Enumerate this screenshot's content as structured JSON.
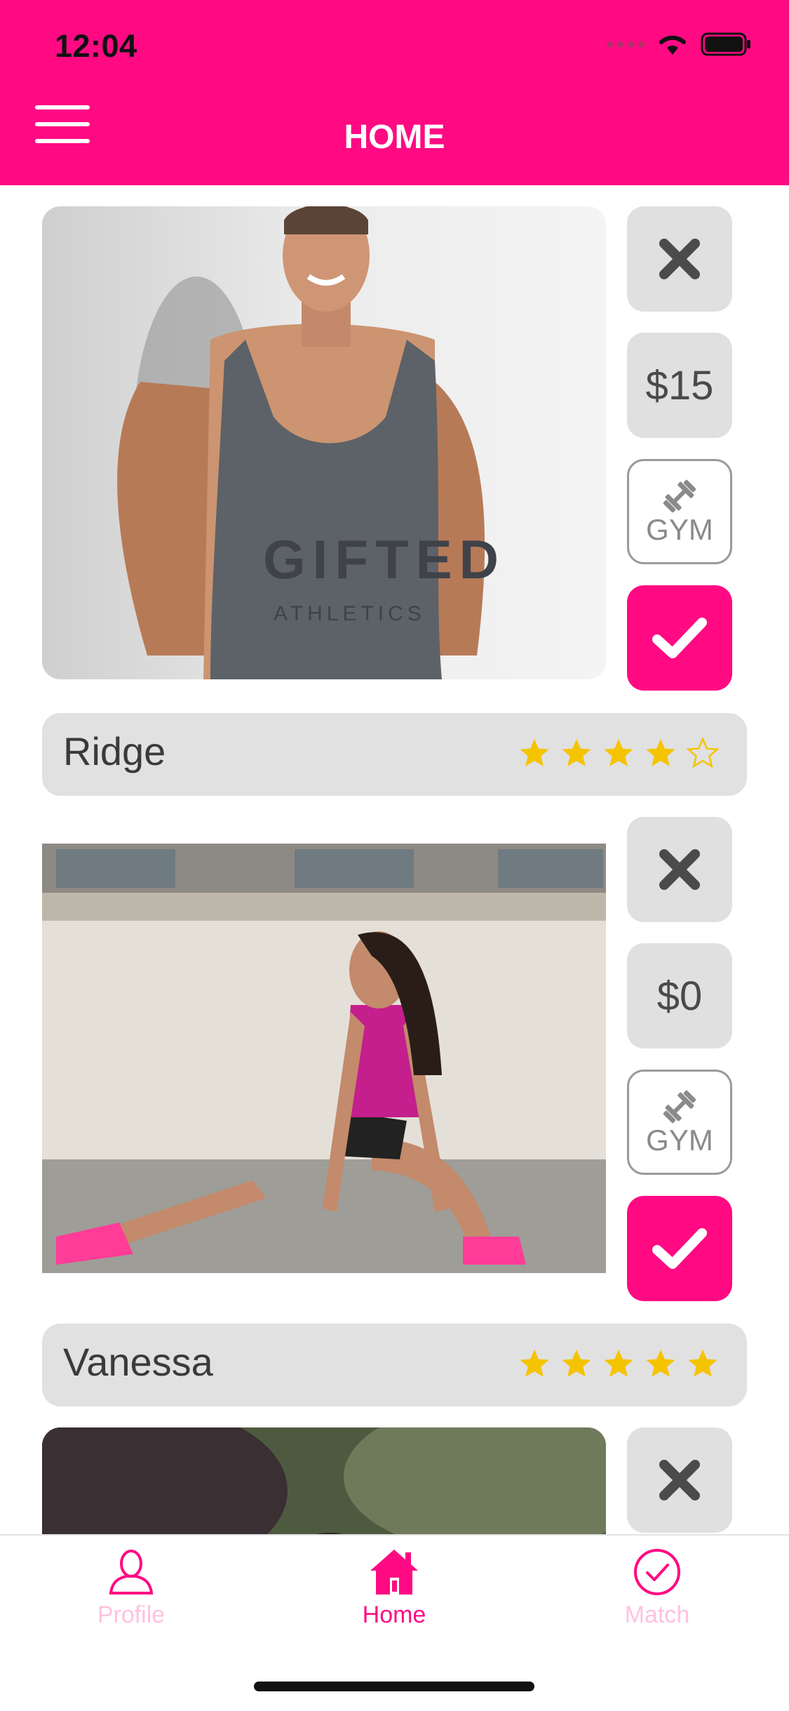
{
  "theme": {
    "accent": "#ff0a83",
    "inactive_tab": "#ffc2dd",
    "star": "#f5c400"
  },
  "status_bar": {
    "time": "12:04"
  },
  "header": {
    "title": "HOME",
    "menu_icon": "hamburger-menu-icon"
  },
  "cards": [
    {
      "name": "Ridge",
      "price": "$15",
      "gym_label": "GYM",
      "rating": 4,
      "max_rating": 5
    },
    {
      "name": "Vanessa",
      "price": "$0",
      "gym_label": "GYM",
      "rating": 5,
      "max_rating": 5
    },
    {
      "name": "",
      "price": "",
      "gym_label": "",
      "rating": 0,
      "max_rating": 5
    }
  ],
  "tabbar": {
    "items": [
      {
        "label": "Profile",
        "icon": "person-icon",
        "active": false
      },
      {
        "label": "Home",
        "icon": "home-icon",
        "active": true
      },
      {
        "label": "Match",
        "icon": "check-circle-icon",
        "active": false
      }
    ]
  }
}
